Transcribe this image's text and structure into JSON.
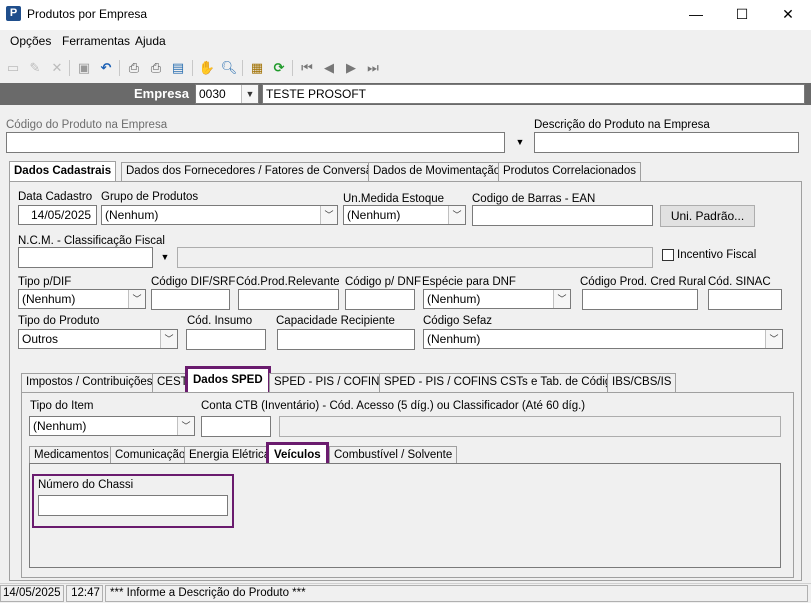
{
  "window": {
    "title": "Produtos por Empresa",
    "icon_letter": "P",
    "minimize": "—",
    "maximize": "☐",
    "close": "✕"
  },
  "menu": [
    "Opções",
    "Ferramentas",
    "Ajuda"
  ],
  "empresa": {
    "label": "Empresa",
    "code": "0030",
    "name": "TESTE PROSOFT"
  },
  "produto": {
    "codigo_label": "Código do Produto na Empresa",
    "descricao_label": "Descrição do Produto na Empresa"
  },
  "main_tabs": [
    "Dados Cadastrais",
    "Dados dos Fornecedores / Fatores de Conversão",
    "Dados de Movimentação",
    "Produtos Correlacionados"
  ],
  "cadastrais": {
    "data_cadastro_label": "Data Cadastro",
    "data_cadastro": "14/05/2025",
    "grupo_label": "Grupo de Produtos",
    "grupo": "(Nenhum)",
    "unmedida_label": "Un.Medida Estoque",
    "unmedida": "(Nenhum)",
    "ean_label": "Codigo de Barras - EAN",
    "uni_padrao_button": "Uni. Padrão...",
    "ncm_label": "N.C.M. - Classificação Fiscal",
    "incentivo_label": "Incentivo Fiscal",
    "tipo_dif_label": "Tipo p/DIF",
    "tipo_dif": "(Nenhum)",
    "codigo_dif_label": "Código DIF/SRF",
    "cod_prod_relevante_label": "Cód.Prod.Relevante",
    "codigo_dnf_label": "Código p/ DNF",
    "especie_dnf_label": "Espécie para DNF",
    "especie_dnf": "(Nenhum)",
    "cred_rural_label": "Código Prod. Cred Rural",
    "sinac_label": "Cód. SINAC",
    "tipo_produto_label": "Tipo do Produto",
    "tipo_produto": "Outros",
    "cod_insumo_label": "Cód. Insumo",
    "capacidade_label": "Capacidade Recipiente",
    "codigo_sefaz_label": "Código Sefaz",
    "codigo_sefaz": "(Nenhum)"
  },
  "sub_tabs": [
    "Impostos / Contribuições",
    "CEST",
    "Dados SPED",
    "SPED - PIS / COFINS",
    "SPED - PIS / COFINS CSTs e Tab. de Códigos",
    "IBS/CBS/IS"
  ],
  "sped": {
    "tipo_item_label": "Tipo do Item",
    "tipo_item": "(Nenhum)",
    "conta_ctb_label": "Conta CTB (Inventário) - Cód. Acesso (5 díg.) ou Classificador (Até 60 díg.)"
  },
  "inner_tabs": [
    "Medicamentos",
    "Comunicação",
    "Energia Elétrica",
    "Veículos",
    "Combustível / Solvente"
  ],
  "veiculos": {
    "chassi_label": "Número do Chassi",
    "chassi": ""
  },
  "status": {
    "date": "14/05/2025",
    "time": "12:47",
    "message": "*** Informe a Descrição do Produto ***"
  },
  "colors": {
    "highlight": "#6a1b6e",
    "empresa_bar": "#6a6a6a"
  }
}
